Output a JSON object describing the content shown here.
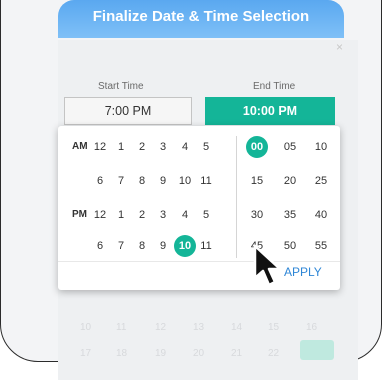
{
  "modal": {
    "title": "Finalize Date & Time Selection",
    "close_label": "×"
  },
  "fields": {
    "start_label": "Start Time",
    "start_value": "7:00 PM",
    "end_label": "End Time",
    "end_value": "10:00 PM"
  },
  "picker": {
    "am_label": "AM",
    "pm_label": "PM",
    "hours_am_row1": [
      "12",
      "1",
      "2",
      "3",
      "4",
      "5"
    ],
    "hours_am_row2": [
      "6",
      "7",
      "8",
      "9",
      "10",
      "11"
    ],
    "hours_pm_row1": [
      "12",
      "1",
      "2",
      "3",
      "4",
      "5"
    ],
    "hours_pm_row2": [
      "6",
      "7",
      "8",
      "9",
      "10",
      "11"
    ],
    "minutes_row1": [
      "00",
      "05",
      "10"
    ],
    "minutes_row2": [
      "15",
      "20",
      "25"
    ],
    "minutes_row3": [
      "30",
      "35",
      "40"
    ],
    "minutes_row4": [
      "45",
      "50",
      "55"
    ],
    "selected_hour": "10",
    "selected_minute": "00",
    "apply_label": "APPLY"
  },
  "background_calendar": {
    "row1": [
      "10",
      "11",
      "12",
      "13",
      "14",
      "15",
      "16"
    ],
    "row2": [
      "17",
      "18",
      "19",
      "20",
      "21",
      "22"
    ]
  },
  "colors": {
    "accent": "#14b598",
    "header": "#5aa8f0",
    "link": "#2e86d6"
  }
}
